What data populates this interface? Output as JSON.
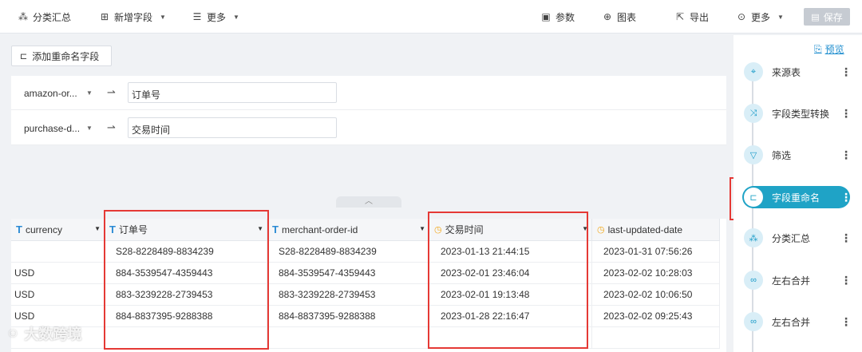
{
  "toolbar": {
    "group_summary": "分类汇总",
    "add_field": "新增字段",
    "more": "更多",
    "params": "参数",
    "chart": "图表",
    "export": "导出",
    "more_right": "更多",
    "save": "保存"
  },
  "add_rename_button": "添加重命名字段",
  "rename_rows": [
    {
      "source": "amazon-or...",
      "target": "订单号"
    },
    {
      "source": "purchase-d...",
      "target": "交易时间"
    }
  ],
  "table": {
    "columns": [
      {
        "name": "currency",
        "type": "text"
      },
      {
        "name": "订单号",
        "type": "text"
      },
      {
        "name": "merchant-order-id",
        "type": "text"
      },
      {
        "name": "交易时间",
        "type": "date"
      },
      {
        "name": "last-updated-date",
        "type": "date"
      }
    ],
    "rows": [
      [
        "",
        "S28-8228489-8834239",
        "S28-8228489-8834239",
        "2023-01-13 21:44:15",
        "2023-01-31 07:56:26"
      ],
      [
        "USD",
        "884-3539547-4359443",
        "884-3539547-4359443",
        "2023-02-01 23:46:04",
        "2023-02-02 10:28:03"
      ],
      [
        "USD",
        "883-3239228-2739453",
        "883-3239228-2739453",
        "2023-02-01 19:13:48",
        "2023-02-02 10:06:50"
      ],
      [
        "USD",
        "884-8837395-9288388",
        "884-8837395-9288388",
        "2023-01-28 22:16:47",
        "2023-02-02 09:25:43"
      ],
      [
        "",
        "",
        "",
        "",
        ""
      ]
    ]
  },
  "flow": {
    "preview": "预览",
    "steps": [
      {
        "label": "来源表",
        "icon": "source-icon",
        "active": false
      },
      {
        "label": "字段类型转换",
        "icon": "shuffle-icon",
        "active": false
      },
      {
        "label": "筛选",
        "icon": "filter-icon",
        "active": false
      },
      {
        "label": "字段重命名",
        "icon": "rename-icon",
        "active": true
      },
      {
        "label": "分类汇总",
        "icon": "group-icon",
        "active": false
      },
      {
        "label": "左右合并",
        "icon": "merge-icon",
        "active": false
      },
      {
        "label": "左右合并",
        "icon": "merge-icon",
        "active": false
      }
    ]
  },
  "watermark": "大数跨境"
}
